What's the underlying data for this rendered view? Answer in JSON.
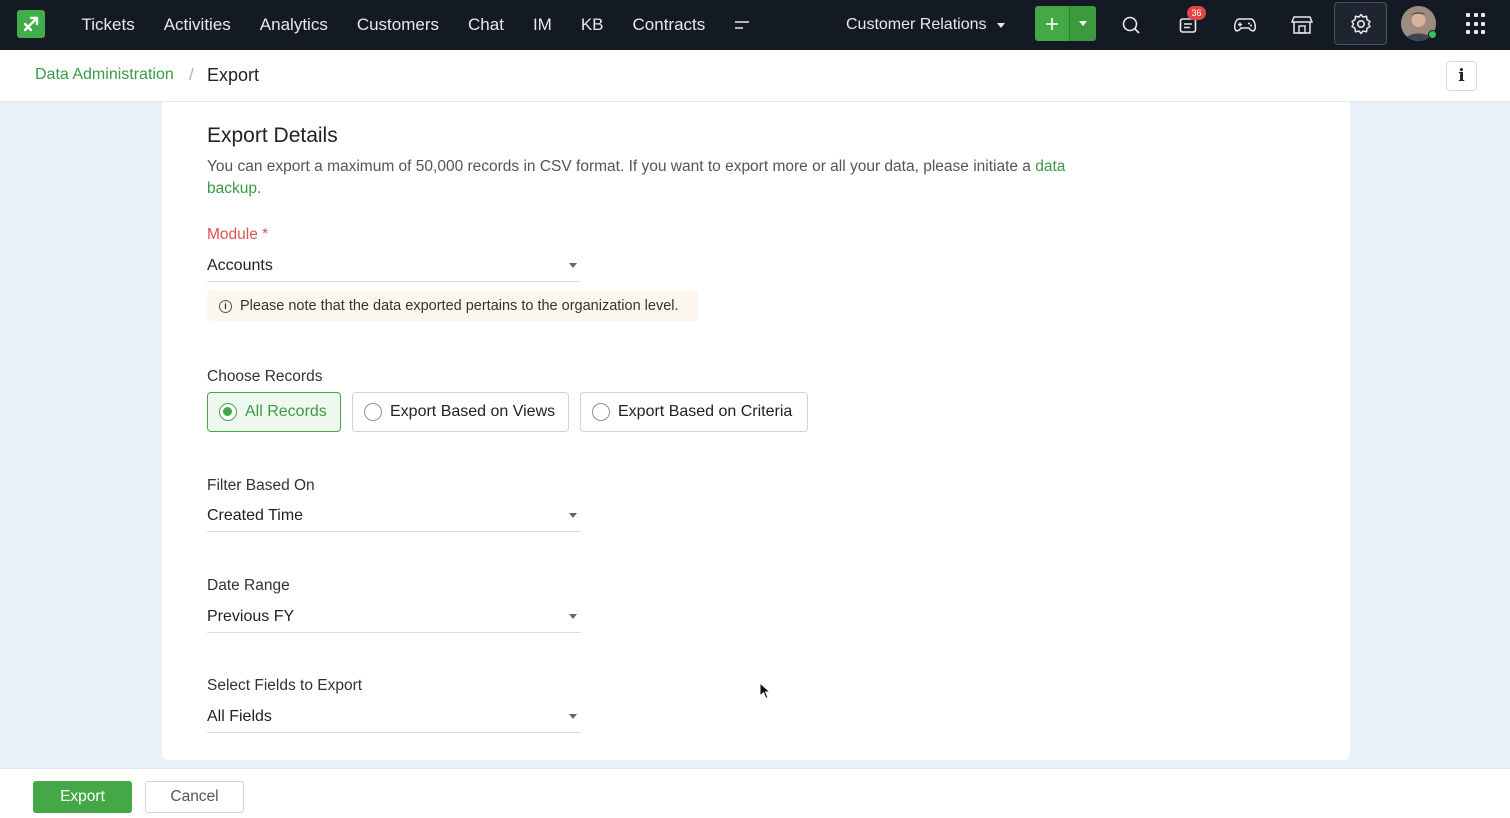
{
  "nav": {
    "items": [
      "Tickets",
      "Activities",
      "Analytics",
      "Customers",
      "Chat",
      "IM",
      "KB",
      "Contracts"
    ],
    "more_icon": "more-menu-icon",
    "department": "Customer Relations",
    "add_icon": "plus-icon",
    "notification_count": "36",
    "icons": [
      "search-icon",
      "notification-icon",
      "gamepad-icon",
      "marketplace-icon",
      "gear-icon",
      "avatar",
      "apps-grid-icon"
    ]
  },
  "breadcrumb": {
    "parent": "Data Administration",
    "separator": "/",
    "current": "Export",
    "info_label": "i"
  },
  "form": {
    "title": "Export Details",
    "desc_text": "You can export a maximum of 50,000 records in CSV format. If you want to export more or all your data, please initiate a ",
    "desc_link": "data backup",
    "desc_end": ".",
    "module_label": "Module *",
    "module_value": "Accounts",
    "note_icon": "i",
    "note": "Please note that the data exported pertains to the organization level.",
    "choose_label": "Choose Records",
    "radios": [
      {
        "label": "All Records",
        "selected": true
      },
      {
        "label": "Export Based on Views",
        "selected": false
      },
      {
        "label": "Export Based on Criteria",
        "selected": false
      }
    ],
    "filter_label": "Filter Based On",
    "filter_value": "Created Time",
    "date_label": "Date Range",
    "date_value": "Previous FY",
    "fields_label": "Select Fields to Export",
    "fields_value": "All Fields"
  },
  "footer": {
    "export_label": "Export",
    "cancel_label": "Cancel"
  },
  "colors": {
    "accent": "#43a845",
    "topbar": "#141a24",
    "required": "#d9534f",
    "badge": "#e04646"
  }
}
